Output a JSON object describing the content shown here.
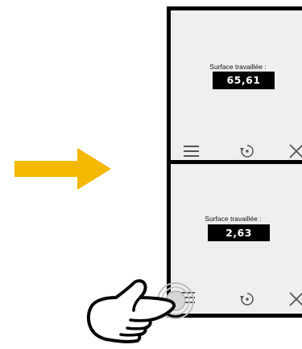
{
  "screens": [
    {
      "id": "top",
      "label": "Surface travaillée :",
      "value": "65,61"
    },
    {
      "id": "bottom",
      "label": "Surface travaillée :",
      "value": "2,63"
    }
  ],
  "colors": {
    "arrow": "#f5b800",
    "screen_bg": "#efefef",
    "frame": "#000000",
    "value_bg": "#000000",
    "value_text": "#ffffff",
    "icon": "#555555"
  },
  "icons": {
    "menu": "menu-icon",
    "reset": "reset-icon",
    "close": "close-icon",
    "hand": "pointing-hand-icon",
    "arrow": "arrow-right-icon"
  }
}
